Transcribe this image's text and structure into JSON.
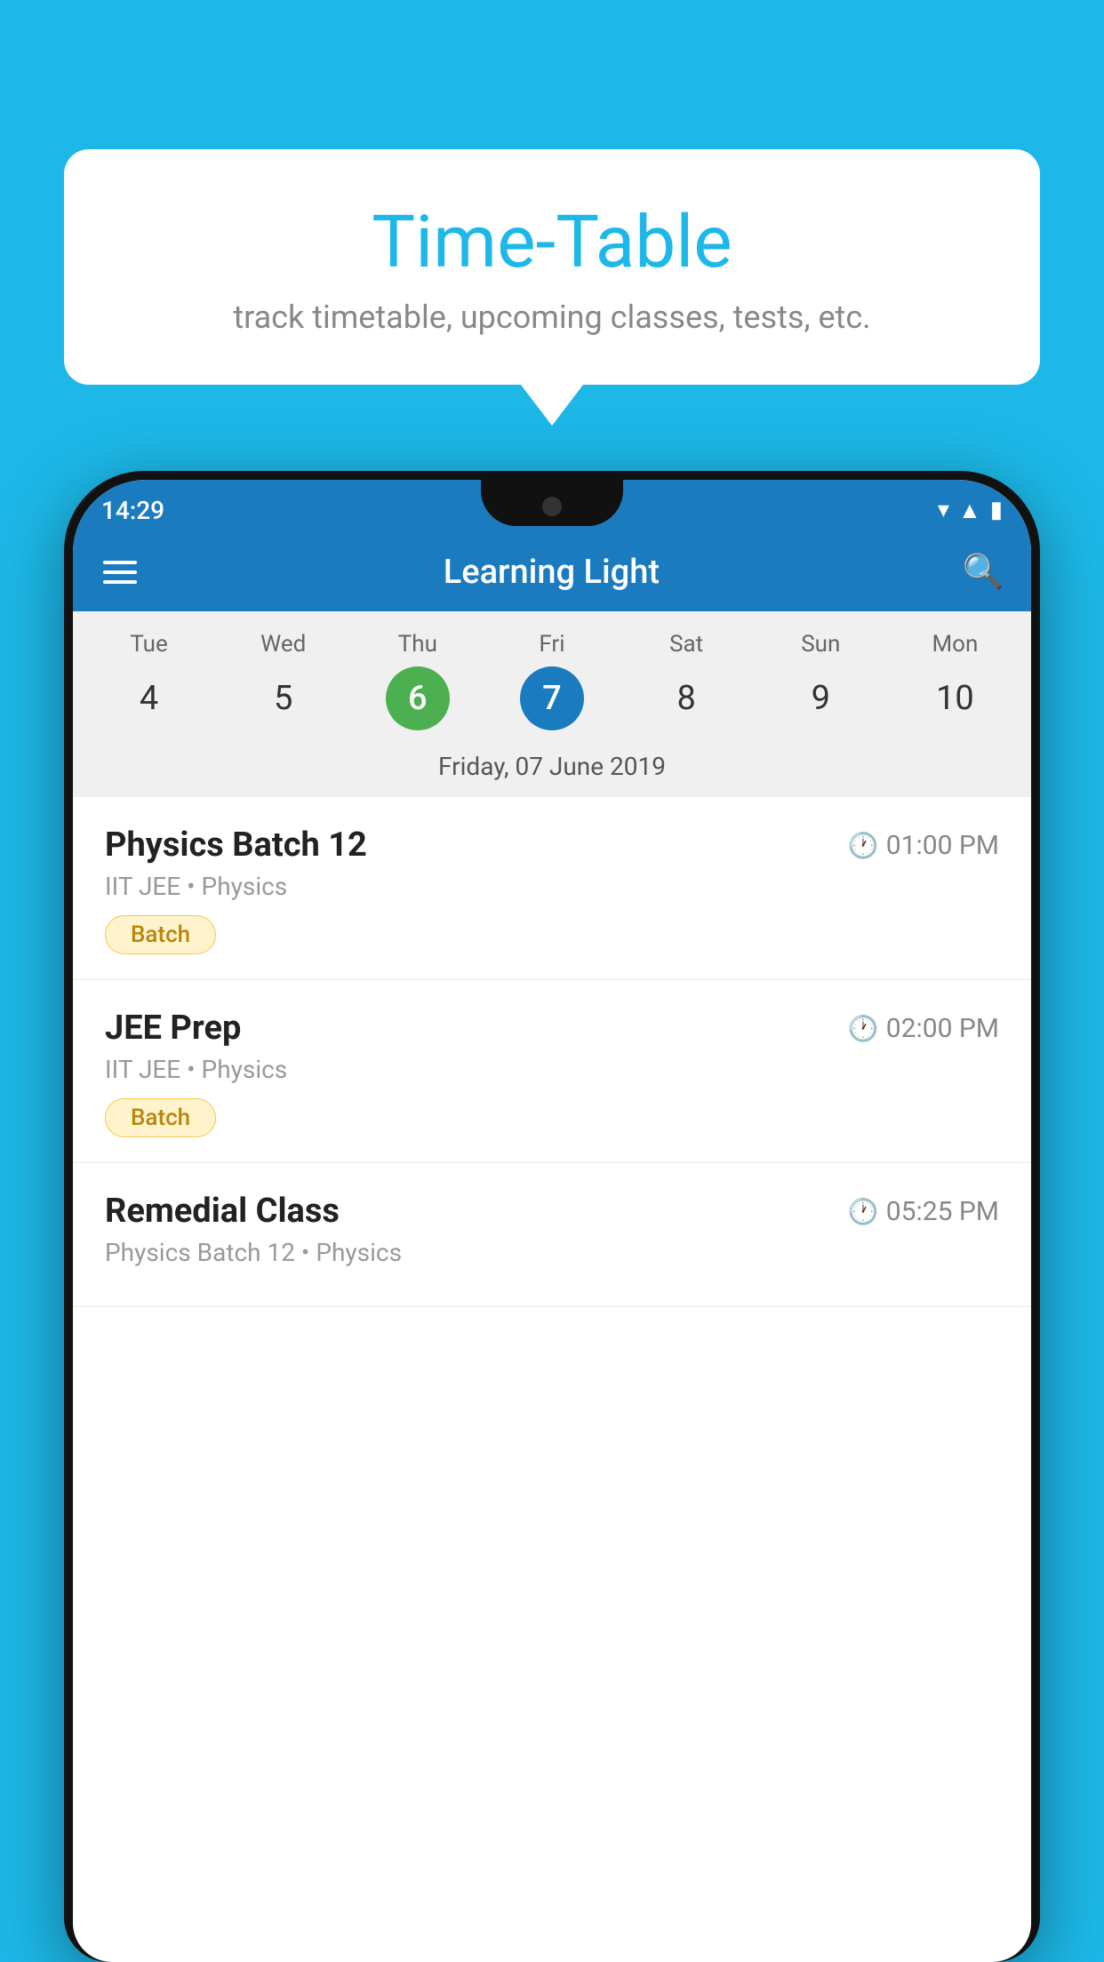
{
  "background_color": "#1DB8E8",
  "bubble": {
    "title": "Time-Table",
    "subtitle": "track timetable, upcoming classes, tests, etc."
  },
  "status_bar": {
    "time": "14:29"
  },
  "toolbar": {
    "title": "Learning Light",
    "menu_label": "Menu",
    "search_label": "Search"
  },
  "calendar": {
    "days": [
      {
        "name": "Tue",
        "number": "4",
        "state": "normal"
      },
      {
        "name": "Wed",
        "number": "5",
        "state": "normal"
      },
      {
        "name": "Thu",
        "number": "6",
        "state": "today"
      },
      {
        "name": "Fri",
        "number": "7",
        "state": "selected"
      },
      {
        "name": "Sat",
        "number": "8",
        "state": "normal"
      },
      {
        "name": "Sun",
        "number": "9",
        "state": "normal"
      },
      {
        "name": "Mon",
        "number": "10",
        "state": "normal"
      }
    ],
    "selected_date_label": "Friday, 07 June 2019"
  },
  "classes": [
    {
      "name": "Physics Batch 12",
      "time": "01:00 PM",
      "meta": "IIT JEE • Physics",
      "badge": "Batch"
    },
    {
      "name": "JEE Prep",
      "time": "02:00 PM",
      "meta": "IIT JEE • Physics",
      "badge": "Batch"
    },
    {
      "name": "Remedial Class",
      "time": "05:25 PM",
      "meta": "Physics Batch 12 • Physics",
      "badge": null
    }
  ]
}
